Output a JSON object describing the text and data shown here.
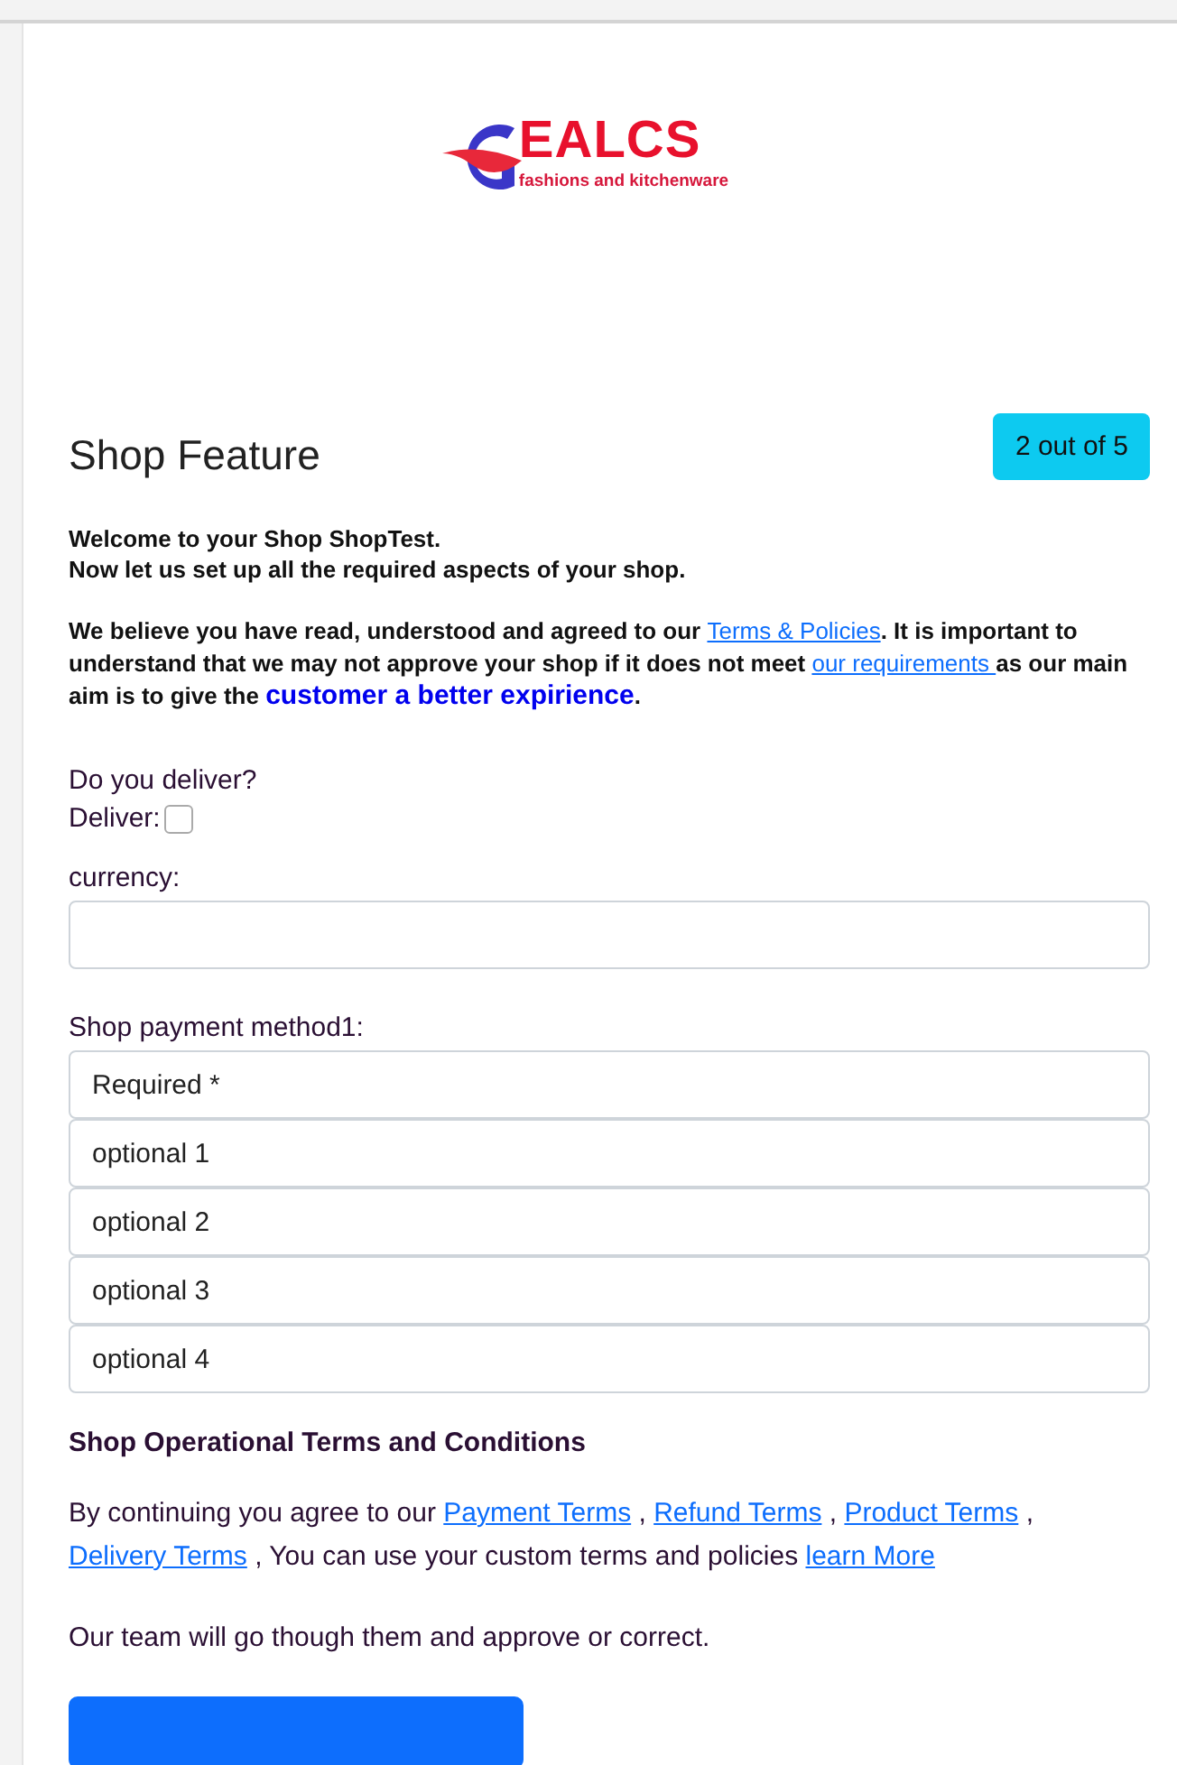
{
  "logo": {
    "name": "EALCS",
    "tagline": "fashions and kitchenware"
  },
  "header": {
    "title": "Shop Feature",
    "step": "2 out of 5"
  },
  "intro": {
    "lines": [
      "Welcome to your Shop ShopTest.",
      "Now let us set up all the required aspects of your shop."
    ],
    "paragraph": [
      {
        "kind": "text",
        "text": "We believe you have read, understood and agreed to our "
      },
      {
        "kind": "link",
        "text": "Terms & Policies"
      },
      {
        "kind": "text",
        "text": ". It is important to understand that we may not approve your shop if it does not meet "
      },
      {
        "kind": "link",
        "text": "our requirements "
      },
      {
        "kind": "text",
        "text": "as our main aim is to give the "
      },
      {
        "kind": "emphasis",
        "text": "customer a better expirience"
      },
      {
        "kind": "text",
        "text": "."
      }
    ]
  },
  "delivery": {
    "question": "Do you deliver?",
    "label": "Deliver:",
    "checked": false
  },
  "currency": {
    "label": "currency:"
  },
  "payment": {
    "label": "Shop payment method1:",
    "fields": [
      {
        "value": "Required *"
      },
      {
        "value": "optional 1"
      },
      {
        "value": "optional 2"
      },
      {
        "value": "optional 3"
      },
      {
        "value": "optional 4"
      }
    ]
  },
  "terms": {
    "heading": "Shop Operational Terms and Conditions",
    "paragraph": [
      {
        "kind": "text",
        "text": "By continuing you agree to our "
      },
      {
        "kind": "link",
        "text": "Payment Terms"
      },
      {
        "kind": "text",
        "text": " , "
      },
      {
        "kind": "link",
        "text": "Refund Terms"
      },
      {
        "kind": "text",
        "text": " , "
      },
      {
        "kind": "link",
        "text": "Product Terms"
      },
      {
        "kind": "text",
        "text": " , "
      },
      {
        "kind": "link",
        "text": "Delivery Terms"
      },
      {
        "kind": "text",
        "text": " , You can use your custom terms and policies "
      },
      {
        "kind": "link",
        "text": "learn More"
      }
    ],
    "note": "Our team will go though them and approve or correct."
  }
}
